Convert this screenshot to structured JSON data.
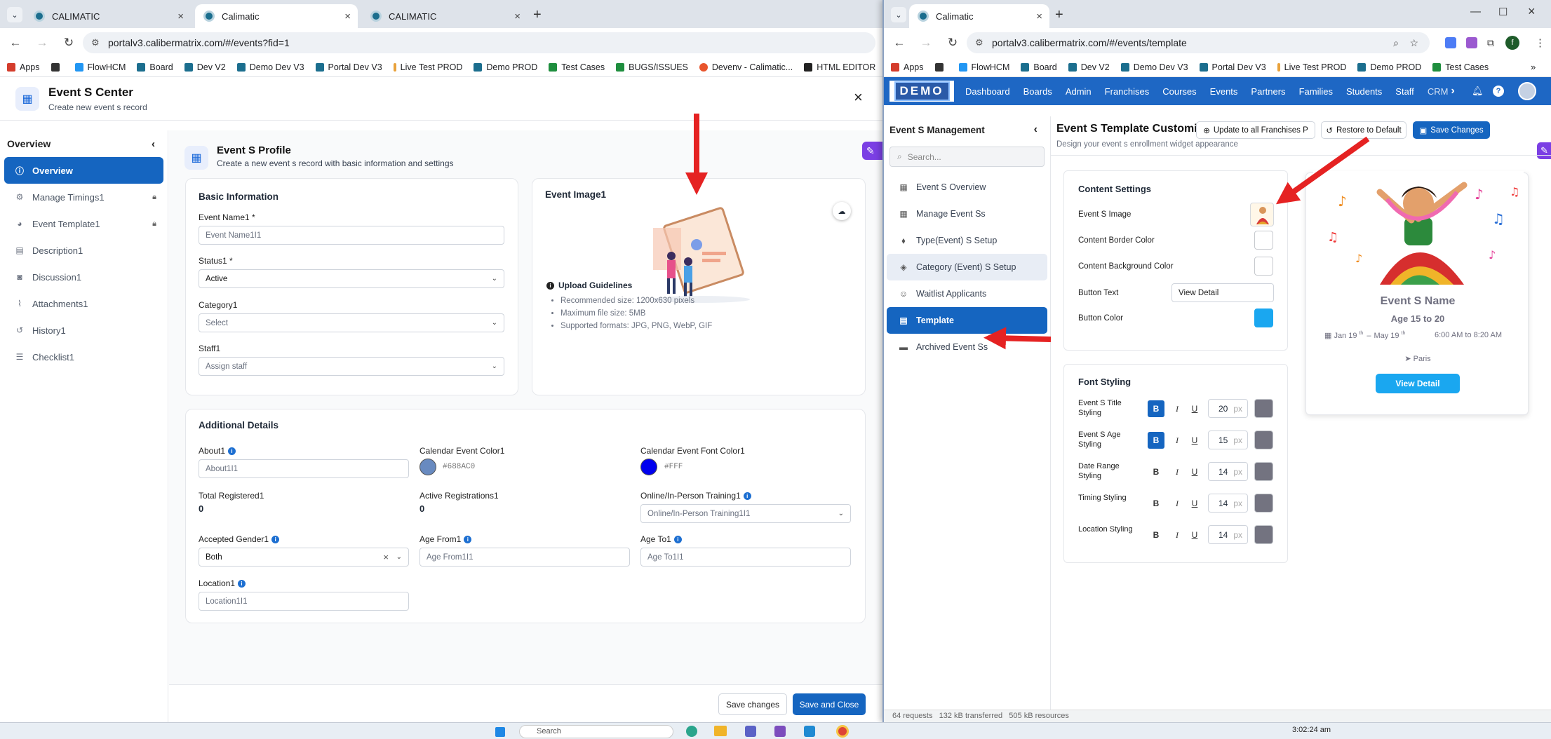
{
  "window1": {
    "tabs": [
      {
        "title": "CALIMATIC"
      },
      {
        "title": "Calimatic"
      },
      {
        "title": "CALIMATIC"
      }
    ],
    "url": "portalv3.calibermatrix.com/#/events?fid=1",
    "bookmarks": [
      "Apps",
      "FlowHCM",
      "Board",
      "Dev V2",
      "Demo Dev V3",
      "Portal Dev V3",
      "Live Test PROD",
      "Demo PROD",
      "Test Cases",
      "BUGS/ISSUES",
      "Devenv - Calimatic...",
      "HTML EDITOR"
    ],
    "modal": {
      "title": "Event S Center",
      "subtitle": "Create new event s record",
      "close_label": "×"
    },
    "sidebar": {
      "heading": "Overview",
      "items": [
        {
          "label": "Overview",
          "icon": "info-icon",
          "locked": false
        },
        {
          "label": "Manage Timings1",
          "icon": "gear-icon",
          "locked": true
        },
        {
          "label": "Event Template1",
          "icon": "palette-icon",
          "locked": true
        },
        {
          "label": "Description1",
          "icon": "document-icon",
          "locked": false
        },
        {
          "label": "Discussion1",
          "icon": "chat-icon",
          "locked": false
        },
        {
          "label": "Attachments1",
          "icon": "paperclip-icon",
          "locked": false
        },
        {
          "label": "History1",
          "icon": "history-icon",
          "locked": false
        },
        {
          "label": "Checklist1",
          "icon": "checklist-icon",
          "locked": false
        }
      ]
    },
    "profile": {
      "title": "Event S Profile",
      "subtitle": "Create a new event s record with basic information and settings"
    },
    "basic_info": {
      "heading": "Basic Information",
      "event_name_label": "Event Name1 *",
      "event_name_placeholder": "Event Name1I1",
      "status_label": "Status1 *",
      "status_value": "Active",
      "category_label": "Category1",
      "category_value": "Select",
      "staff_label": "Staff1",
      "staff_value": "Assign staff"
    },
    "event_image": {
      "heading": "Event Image1",
      "guidelines_title": "Upload Guidelines",
      "guidelines": [
        "Recommended size: 1200x630 pixels",
        "Maximum file size: 5MB",
        "Supported formats: JPG, PNG, WebP, GIF"
      ]
    },
    "additional": {
      "heading": "Additional Details",
      "about_label": "About1",
      "about_placeholder": "About1I1",
      "cal_color_label": "Calendar Event Color1",
      "cal_color_value": "#688AC0",
      "cal_font_color_label": "Calendar Event Font Color1",
      "cal_font_color_value": "#FFF",
      "total_registered_label": "Total Registered1",
      "total_registered_value": "0",
      "active_reg_label": "Active Registrations1",
      "active_reg_value": "0",
      "training_label": "Online/In-Person Training1",
      "training_value": "Online/In-Person Training1I1",
      "gender_label": "Accepted Gender1",
      "gender_value": "Both",
      "age_from_label": "Age From1",
      "age_from_placeholder": "Age From1I1",
      "age_to_label": "Age To1",
      "age_to_placeholder": "Age To1I1",
      "location_label": "Location1",
      "location_placeholder": "Location1I1"
    },
    "footer": {
      "save_changes": "Save changes",
      "save_close": "Save and Close"
    }
  },
  "window2": {
    "tab_title": "Calimatic",
    "url": "portalv3.calibermatrix.com/#/events/template",
    "bookmarks": [
      "Apps",
      "FlowHCM",
      "Board",
      "Dev V2",
      "Demo Dev V3",
      "Portal Dev V3",
      "Live Test PROD",
      "Demo PROD",
      "Test Cases"
    ],
    "logo": "DEMO",
    "nav": [
      "Dashboard",
      "Boards",
      "Admin",
      "Franchises",
      "Courses",
      "Events",
      "Partners",
      "Families",
      "Students",
      "Staff",
      "CRM"
    ],
    "management": {
      "title": "Event S Management",
      "search_placeholder": "Search...",
      "items": [
        {
          "label": "Event S Overview",
          "icon": "calendar-icon"
        },
        {
          "label": "Manage Event Ss",
          "icon": "calendar-edit-icon"
        },
        {
          "label": "Type(Event) S Setup",
          "icon": "tag-icon"
        },
        {
          "label": "Category (Event) S Setup",
          "icon": "layers-icon"
        },
        {
          "label": "Waitlist Applicants",
          "icon": "user-clock-icon"
        },
        {
          "label": "Template",
          "icon": "template-icon"
        },
        {
          "label": "Archived Event Ss",
          "icon": "archive-icon"
        }
      ]
    },
    "customization": {
      "title": "Event S Template Customization",
      "subtitle": "Design your event s enrollment widget appearance",
      "update_all": "Update to all Franchises P",
      "restore": "Restore to Default",
      "save": "Save Changes"
    },
    "content_settings": {
      "heading": "Content Settings",
      "image_label": "Event S Image",
      "border_color_label": "Content Border Color",
      "bg_color_label": "Content Background Color",
      "button_text_label": "Button Text",
      "button_text_value": "View Detail",
      "button_color_label": "Button Color",
      "button_color": "#1aa7f0"
    },
    "font_styling": {
      "heading": "Font Styling",
      "rows": [
        {
          "label": "Event S Title Styling",
          "bold": true,
          "size": "20"
        },
        {
          "label": "Event S Age Styling",
          "bold": true,
          "size": "15"
        },
        {
          "label": "Date Range Styling",
          "bold": false,
          "size": "14"
        },
        {
          "label": "Timing Styling",
          "bold": false,
          "size": "14"
        },
        {
          "label": "Location Styling",
          "bold": false,
          "size": "14"
        }
      ],
      "px_unit": "px"
    },
    "preview": {
      "name": "Event S Name",
      "age": "Age 15 to 20",
      "date_start": "Jan 19",
      "date_end": "May 19",
      "th": "th",
      "time": "6:00 AM to 8:20 AM",
      "location": "Paris",
      "button": "View Detail"
    },
    "devtools_status": "64 requests   132 kB transferred   505 kB resources"
  },
  "taskbar": {
    "search": "Search",
    "time": "3:02:24 am"
  }
}
